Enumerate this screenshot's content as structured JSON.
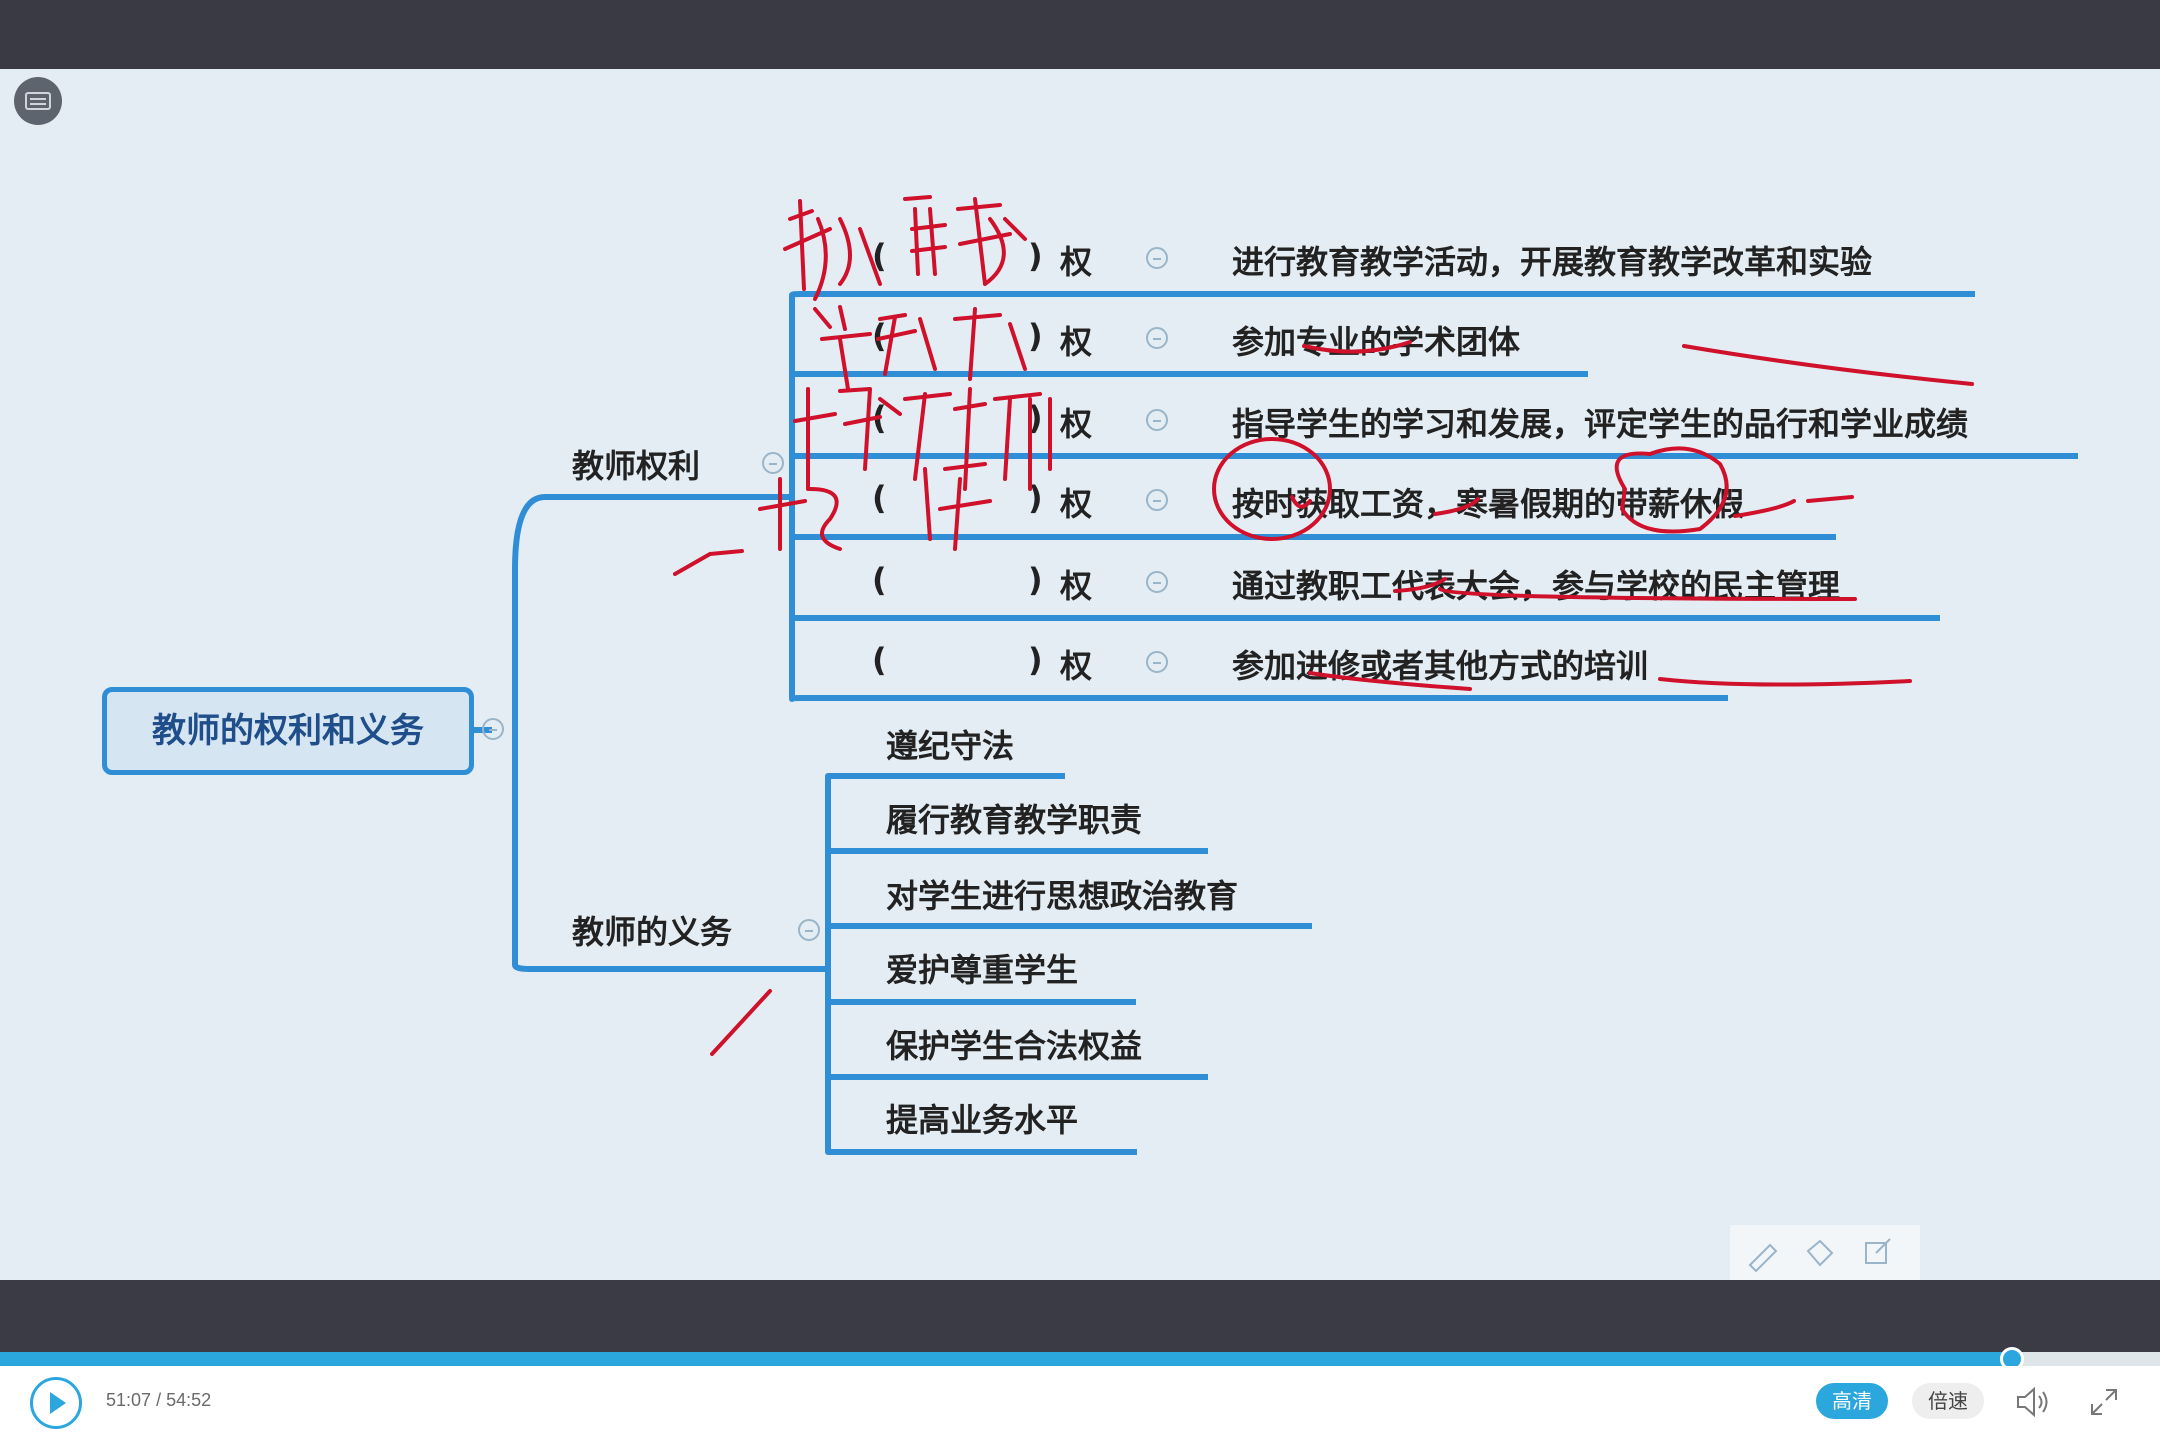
{
  "mindmap": {
    "root": "教师的权利和义务",
    "rights": {
      "title": "教师权利",
      "suffix": "权",
      "paren_open": "(",
      "paren_close": ")",
      "items": [
        "进行教育教学活动，开展教育教学改革和实验",
        "参加专业的学术团体",
        "指导学生的学习和发展，评定学生的品行和学业成绩",
        "按时获取工资，寒暑假期的带薪休假",
        "通过教职工代表大会，参与学校的民主管理",
        "参加进修或者其他方式的培训"
      ]
    },
    "duties": {
      "title": "教师的义务",
      "items": [
        "遵纪守法",
        "履行教育教学职责",
        "对学生进行思想政治教育",
        "爱护尊重学生",
        "保护学生合法权益",
        "提高业务水平"
      ]
    }
  },
  "annotation_color": "#d0112b",
  "player": {
    "time_current": "51:07",
    "time_separator": "/",
    "time_total": "54:52",
    "progress": 0.9316,
    "quality_label": "高清",
    "speed_label": "倍速",
    "accent": "#2ba7de"
  }
}
